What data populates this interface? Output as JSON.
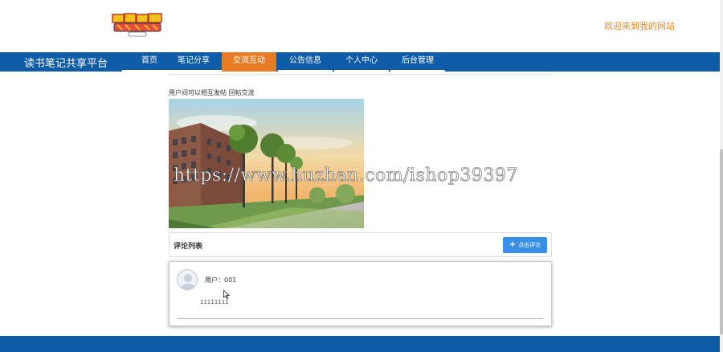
{
  "header": {
    "welcome": "欢迎来到我的网站"
  },
  "navbar": {
    "brand": "读书笔记共享平台",
    "items": [
      {
        "label": "首页"
      },
      {
        "label": "笔记分享"
      },
      {
        "label": "交流互动",
        "active": true
      },
      {
        "label": "公告信息"
      },
      {
        "label": "个人中心"
      },
      {
        "label": "后台管理"
      }
    ]
  },
  "main": {
    "intro": "用户间可以相互发帖 回帖交流",
    "watermark": "https://www.huzhan.com/ishop39397"
  },
  "comments": {
    "title": "评论列表",
    "add_button": "点击评论",
    "items": [
      {
        "user_label": "用户：",
        "user": "001",
        "text": "11111111"
      }
    ]
  },
  "colors": {
    "nav_bg": "#0e5ba8",
    "active_tab": "#e87c25",
    "welcome_text": "#e8872a",
    "button": "#3a8ee6"
  }
}
